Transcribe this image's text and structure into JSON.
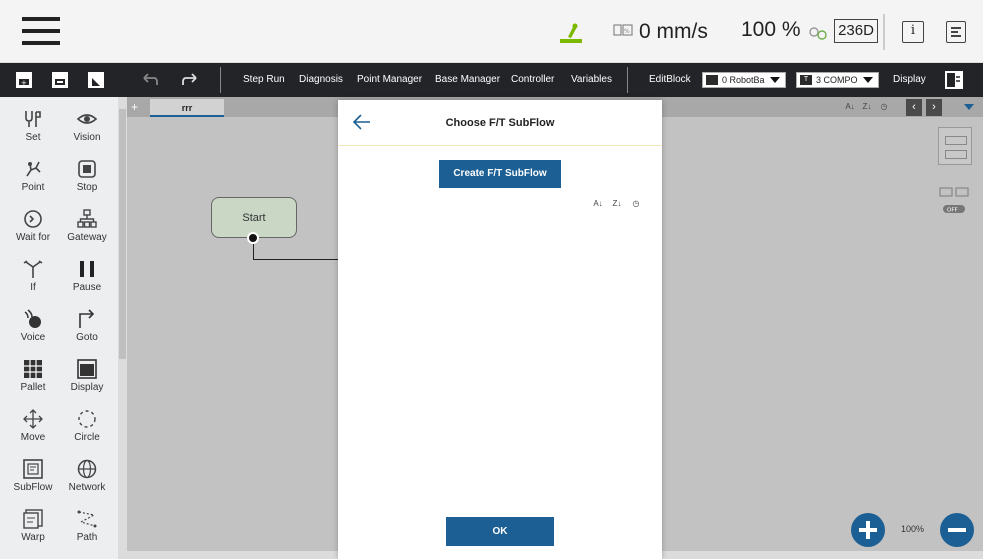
{
  "status_bar": {
    "speed": "0 mm/s",
    "percent": "100 %",
    "mode": "236D",
    "info_label": "i"
  },
  "toolbar": {
    "step_run": "Step Run",
    "diagnosis": "Diagnosis",
    "point_manager": "Point Manager",
    "base_manager": "Base Manager",
    "controller": "Controller",
    "variables": "Variables",
    "edit_block": "EditBlock",
    "robot_base": {
      "badge": "",
      "value": "0 RobotBa"
    },
    "tool": {
      "badge": "T",
      "value": "3 COMPO"
    },
    "display": "Display"
  },
  "palette": [
    {
      "label": "Set",
      "icon": "set-icon"
    },
    {
      "label": "Vision",
      "icon": "vision-icon"
    },
    {
      "label": "Point",
      "icon": "point-icon"
    },
    {
      "label": "Stop",
      "icon": "stop-icon"
    },
    {
      "label": "Wait for",
      "icon": "wait-icon"
    },
    {
      "label": "Gateway",
      "icon": "gateway-icon"
    },
    {
      "label": "If",
      "icon": "if-icon"
    },
    {
      "label": "Pause",
      "icon": "pause-icon"
    },
    {
      "label": "Voice",
      "icon": "voice-icon"
    },
    {
      "label": "Goto",
      "icon": "goto-icon"
    },
    {
      "label": "Pallet",
      "icon": "pallet-icon"
    },
    {
      "label": "Display",
      "icon": "display-icon"
    },
    {
      "label": "Move",
      "icon": "move-icon"
    },
    {
      "label": "Circle",
      "icon": "circle-icon"
    },
    {
      "label": "SubFlow",
      "icon": "subflow-icon"
    },
    {
      "label": "Network",
      "icon": "network-icon"
    },
    {
      "label": "Warp",
      "icon": "warp-icon"
    },
    {
      "label": "Path",
      "icon": "path-icon"
    }
  ],
  "canvas": {
    "tab_add": "+",
    "active_tab": "rrr",
    "start_node": "Start",
    "zoom": "100%",
    "toggle_label": "OFF"
  },
  "dialog": {
    "title": "Choose F/T SubFlow",
    "create_button": "Create F/T SubFlow",
    "ok_button": "OK"
  },
  "colors": {
    "accent": "#1b5f94",
    "toolbar_bg": "#222428",
    "canvas_bg": "#c2c2c2",
    "start_node_fill": "#c9d7c4",
    "robot_status": "#7cb800"
  }
}
